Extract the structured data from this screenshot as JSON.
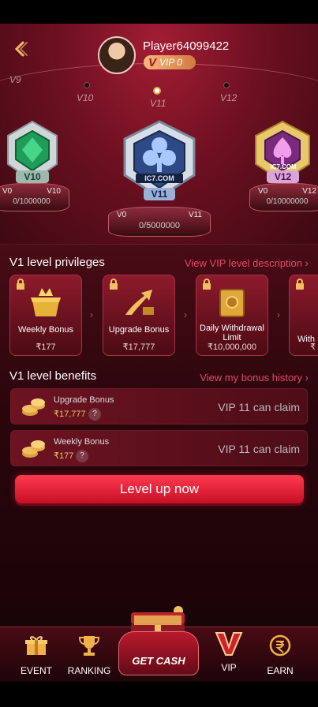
{
  "header": {
    "player_name": "Player64099422",
    "vip_letter": "V",
    "vip_label": "VIP 0"
  },
  "levels_ruler": {
    "ticks": [
      "V9",
      "V10",
      "V11",
      "V12"
    ],
    "current": "V11"
  },
  "emblems": {
    "left": {
      "label": "V10",
      "from": "V0",
      "to": "V10",
      "progress": "0/1000000"
    },
    "center": {
      "label": "V11",
      "brand": "IC7.COM",
      "from": "V0",
      "to": "V11",
      "progress": "0/5000000"
    },
    "right": {
      "label": "V12",
      "brand": "IC7.COM",
      "from": "V0",
      "to": "V12",
      "progress": "0/10000000"
    }
  },
  "privileges": {
    "title": "V1 level privileges",
    "link": "View VIP level description",
    "cards": [
      {
        "name": "Weekly Bonus",
        "amount": "₹177"
      },
      {
        "name": "Upgrade Bonus",
        "amount": "₹17,777"
      },
      {
        "name": "Daily Withdrawal Limit",
        "amount": "₹10,000,000"
      },
      {
        "name": "With",
        "amount": "₹"
      }
    ]
  },
  "benefits": {
    "title": "V1 level benefits",
    "link": "View my bonus history",
    "items": [
      {
        "name": "Upgrade Bonus",
        "amount": "₹17,777",
        "status": "VIP 11 can claim"
      },
      {
        "name": "Weekly Bonus",
        "amount": "₹177",
        "status": "VIP 11 can claim"
      }
    ]
  },
  "level_up_button": "Level up now",
  "nav": {
    "event": "EVENT",
    "ranking": "RANKING",
    "get_cash": "GET CASH",
    "vip": "VIP",
    "earn": "EARN"
  },
  "colors": {
    "accent": "#e6476a",
    "button": "#e11a32",
    "gold": "#f1c05e"
  }
}
